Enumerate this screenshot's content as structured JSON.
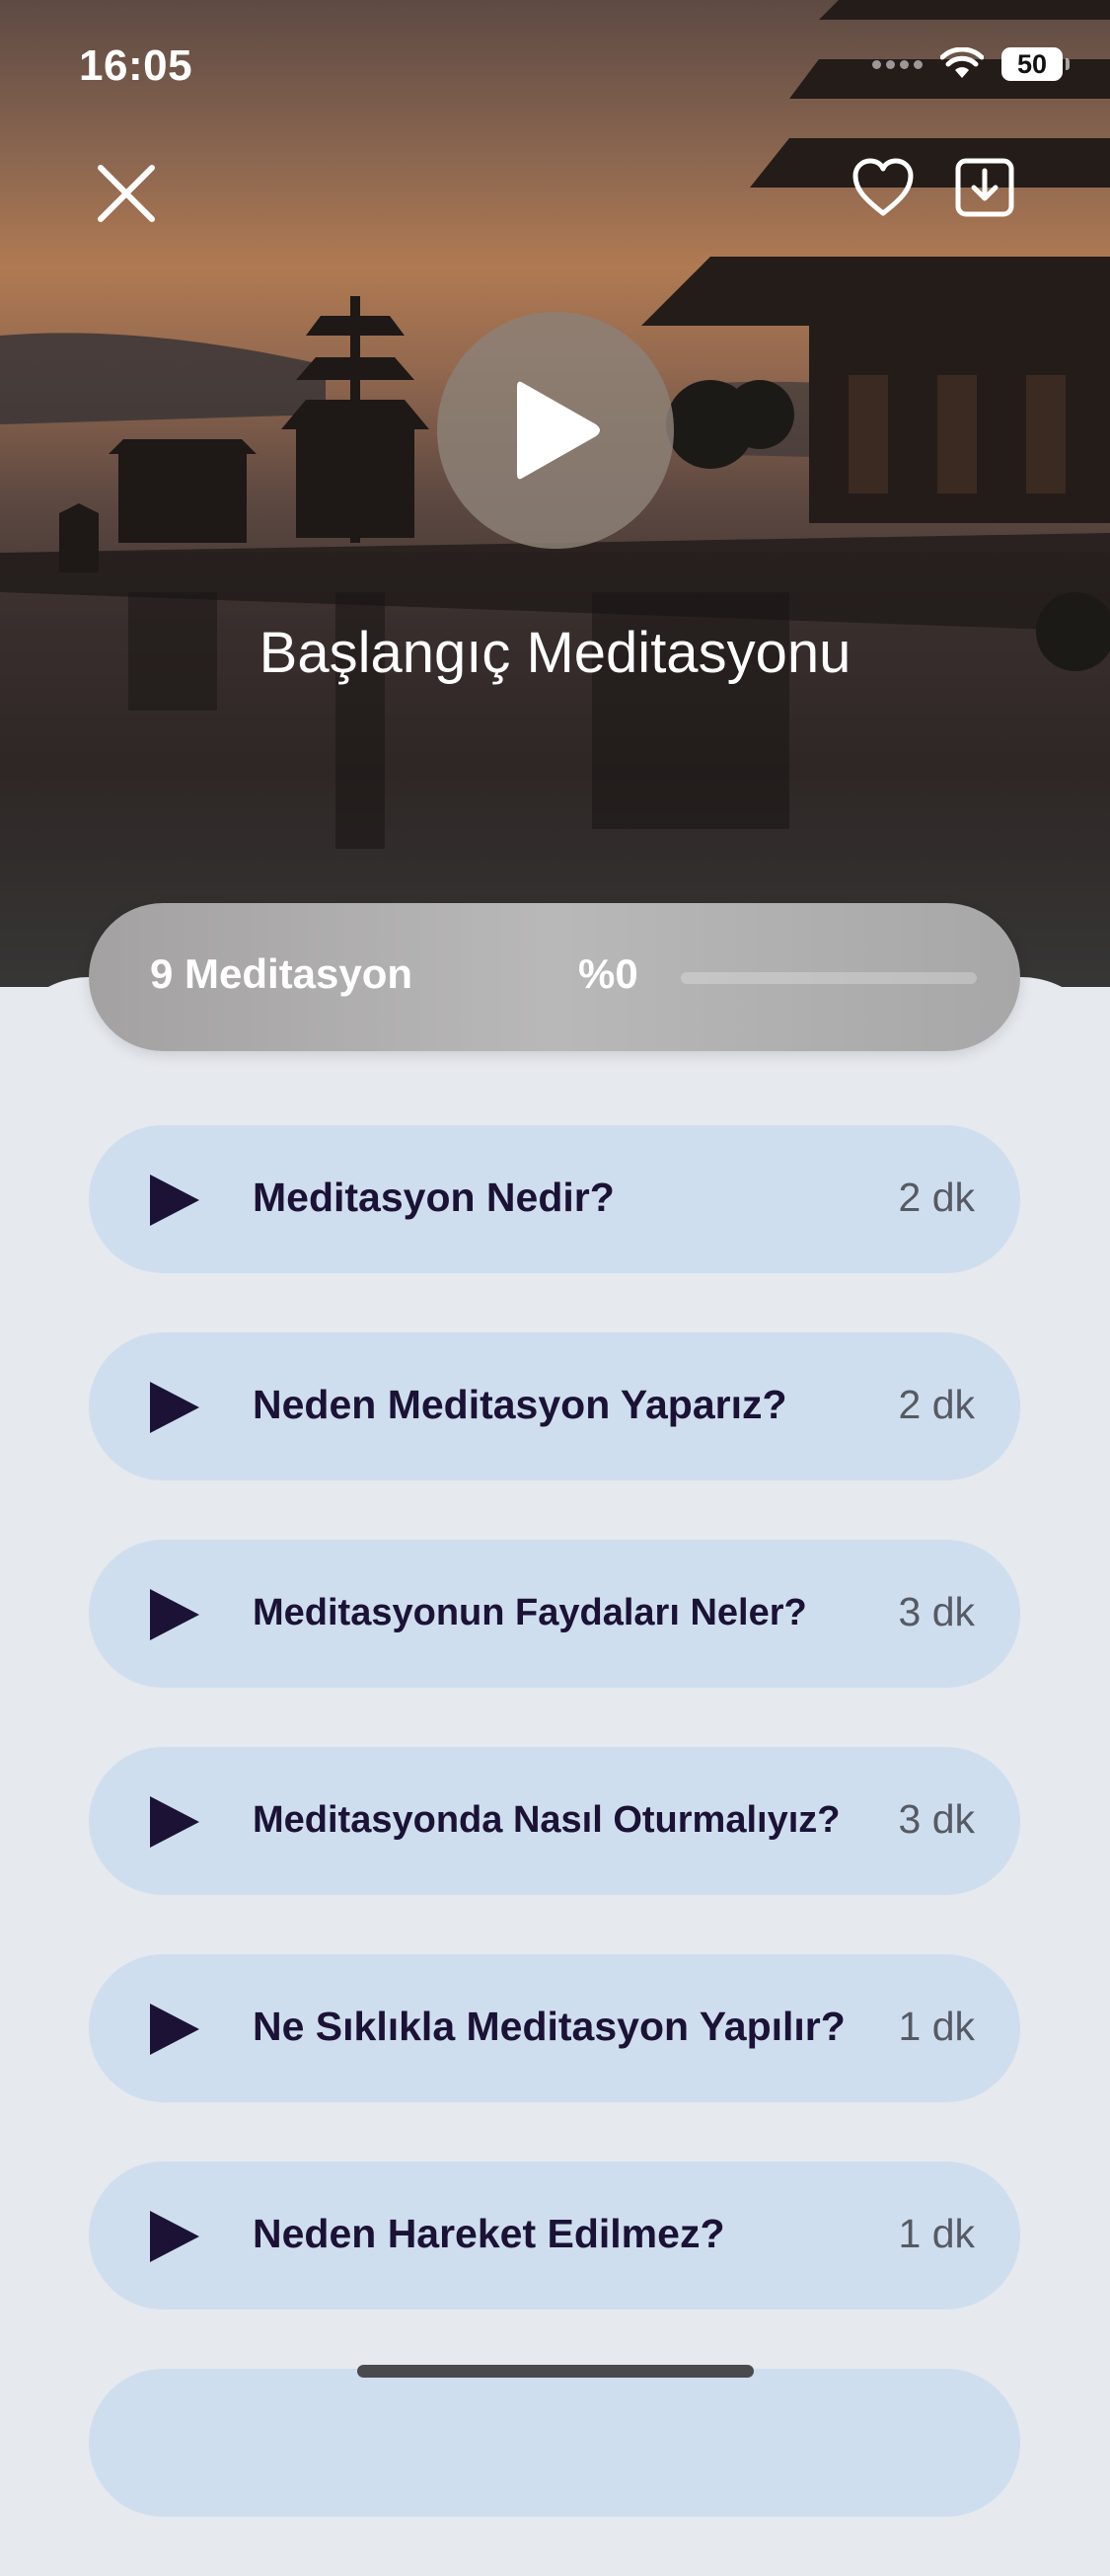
{
  "status_bar": {
    "time": "16:05",
    "battery": "50"
  },
  "header": {
    "close_icon": "close-icon",
    "favorite_icon": "heart-icon",
    "download_icon": "download-icon",
    "play_icon": "play-icon",
    "title": "Başlangıç Meditasyonu"
  },
  "progress": {
    "count_label": "9 Meditasyon",
    "percent_label": "%0",
    "fraction": 0
  },
  "lessons": [
    {
      "title": "Meditasyon Nedir?",
      "duration": "2 dk"
    },
    {
      "title": "Neden Meditasyon Yaparız?",
      "duration": "2 dk"
    },
    {
      "title": "Meditasyonun Faydaları Neler?",
      "duration": "3 dk"
    },
    {
      "title": "Meditasyonda Nasıl Oturmalıyız?",
      "duration": "3 dk"
    },
    {
      "title": "Ne Sıklıkla Meditasyon Yapılır?",
      "duration": "1 dk"
    },
    {
      "title": "Neden Hareket Edilmez?",
      "duration": "1 dk"
    }
  ],
  "colors": {
    "accent_play": "#1b1236",
    "row_bg": "#cfdeee",
    "sheet_bg": "#e6e9ee"
  }
}
